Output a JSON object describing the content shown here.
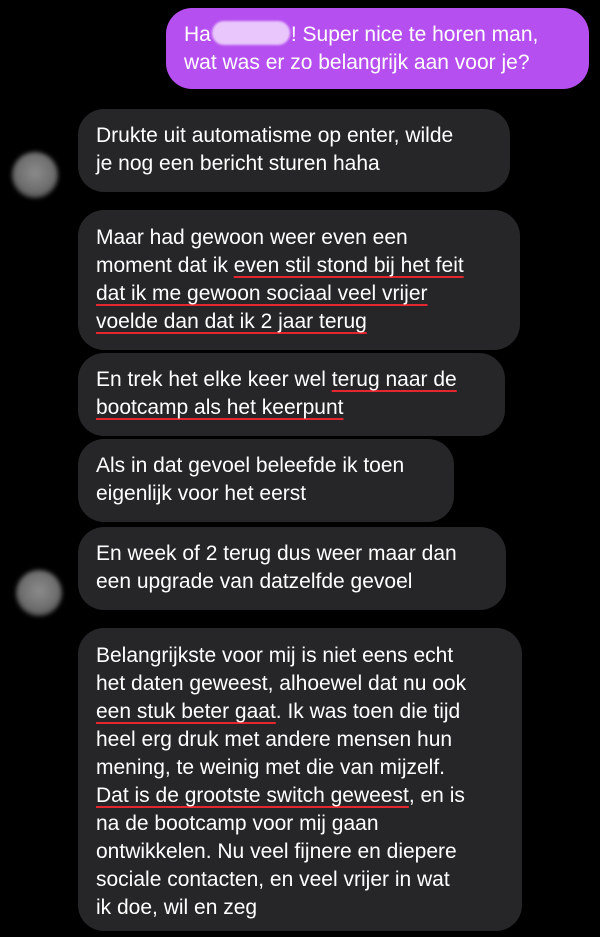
{
  "thread": {
    "outgoing": {
      "line1": {
        "before": "Ha",
        "after": "! Super nice te horen man,"
      },
      "line2": "wat was er zo belangrijk aan voor je?"
    },
    "messages": {
      "m1": {
        "line1": "Drukte uit automatisme op enter, wilde",
        "line2": "je nog een bericht sturen haha"
      },
      "m2": {
        "line1": "Maar had gewoon weer even een",
        "line2_a": "moment dat ik ",
        "line2_b": "even stil stond bij het feit",
        "line3": "dat ik me gewoon sociaal veel vrijer",
        "line4": "voelde dan dat ik 2 jaar terug"
      },
      "m3": {
        "line1_a": "En trek het elke keer wel ",
        "line1_b": "terug naar de",
        "line2": "bootcamp als het keerpunt"
      },
      "m4": {
        "line1": "Als in dat gevoel beleefde ik toen",
        "line2": "eigenlijk voor het eerst"
      },
      "m5": {
        "line1": "En week of 2 terug dus weer maar dan",
        "line2": "een upgrade van datzelfde gevoel"
      },
      "m6": {
        "line1": "Belangrijkste voor mij is niet eens echt",
        "line2": "het daten geweest, alhoewel dat nu ook",
        "line3_a": "een stuk beter gaat",
        "line3_b": ". Ik was toen die tijd",
        "line4": "heel erg druk met andere mensen hun",
        "line5": "mening, te weinig met die van mijzelf.",
        "line6_a": "Dat is de grootste switch geweest",
        "line6_b": ", en is",
        "line7": "na de bootcamp voor mij gaan",
        "line8": "ontwikkelen. Nu veel fijnere en diepere",
        "line9": "sociale contacten, en veel vrijer in wat",
        "line10": "ik doe, wil en zeg"
      }
    }
  },
  "colors": {
    "background": "#000000",
    "incoming_bubble": "#262629",
    "outgoing_bubble": "#b64ff0",
    "spellcheck_underline": "#e3262f"
  },
  "icons": {
    "avatar": "blurred-avatar"
  }
}
